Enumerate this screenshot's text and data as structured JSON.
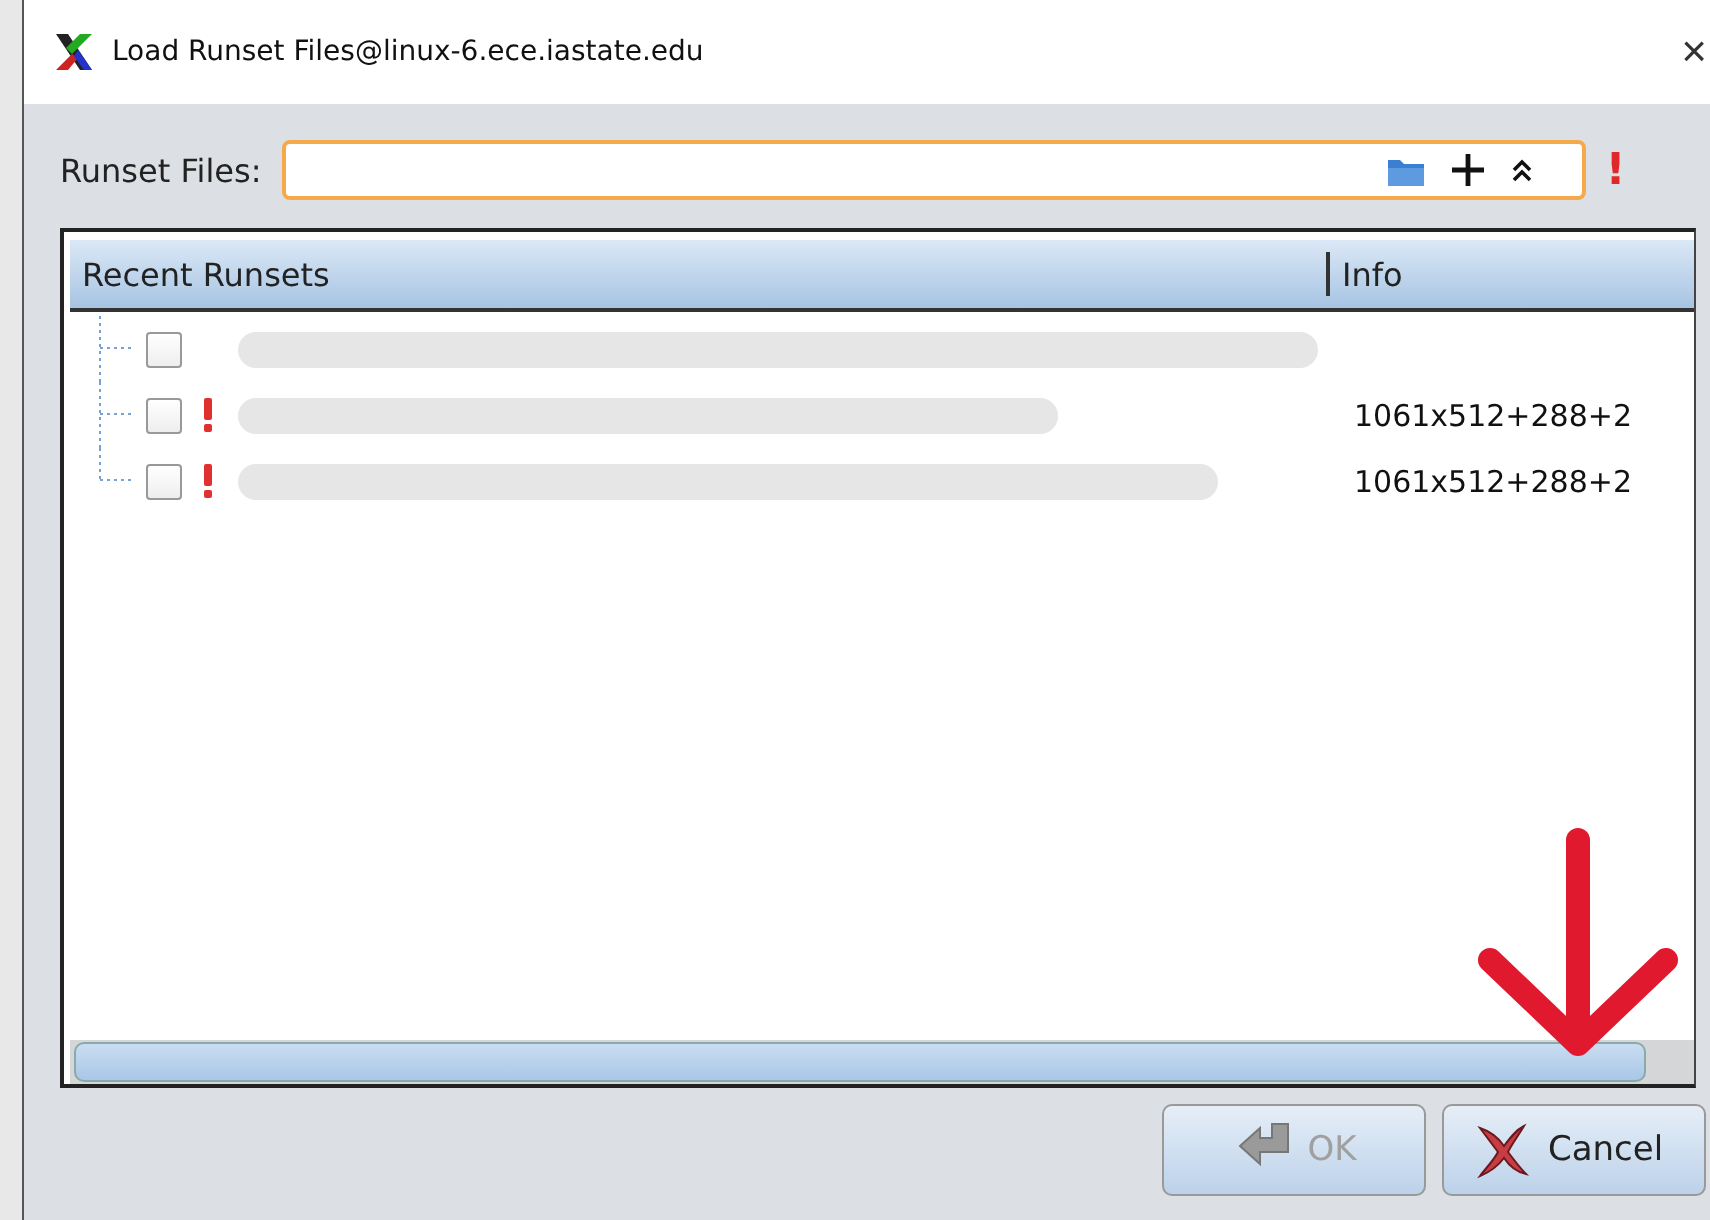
{
  "window": {
    "title": "Load Runset Files@linux-6.ece.iastate.edu",
    "close": "×"
  },
  "runset_field": {
    "label": "Runset Files:",
    "focused": true,
    "warning": "!"
  },
  "table": {
    "columns": [
      "Recent Runsets",
      "Info"
    ],
    "rows": [
      {
        "checked": false,
        "warning": false,
        "path_redacted": true
      },
      {
        "checked": false,
        "warning": true,
        "path_redacted": true,
        "info": "1061x512+288+2"
      },
      {
        "checked": false,
        "warning": true,
        "path_redacted": true,
        "info": "1061x512+288+2"
      }
    ]
  },
  "buttons": [
    {
      "kind": "ok",
      "label": "OK",
      "disabled": true
    },
    {
      "kind": "cancel",
      "label": "Cancel",
      "disabled": false
    }
  ],
  "annotation": {
    "kind": "arrow"
  }
}
